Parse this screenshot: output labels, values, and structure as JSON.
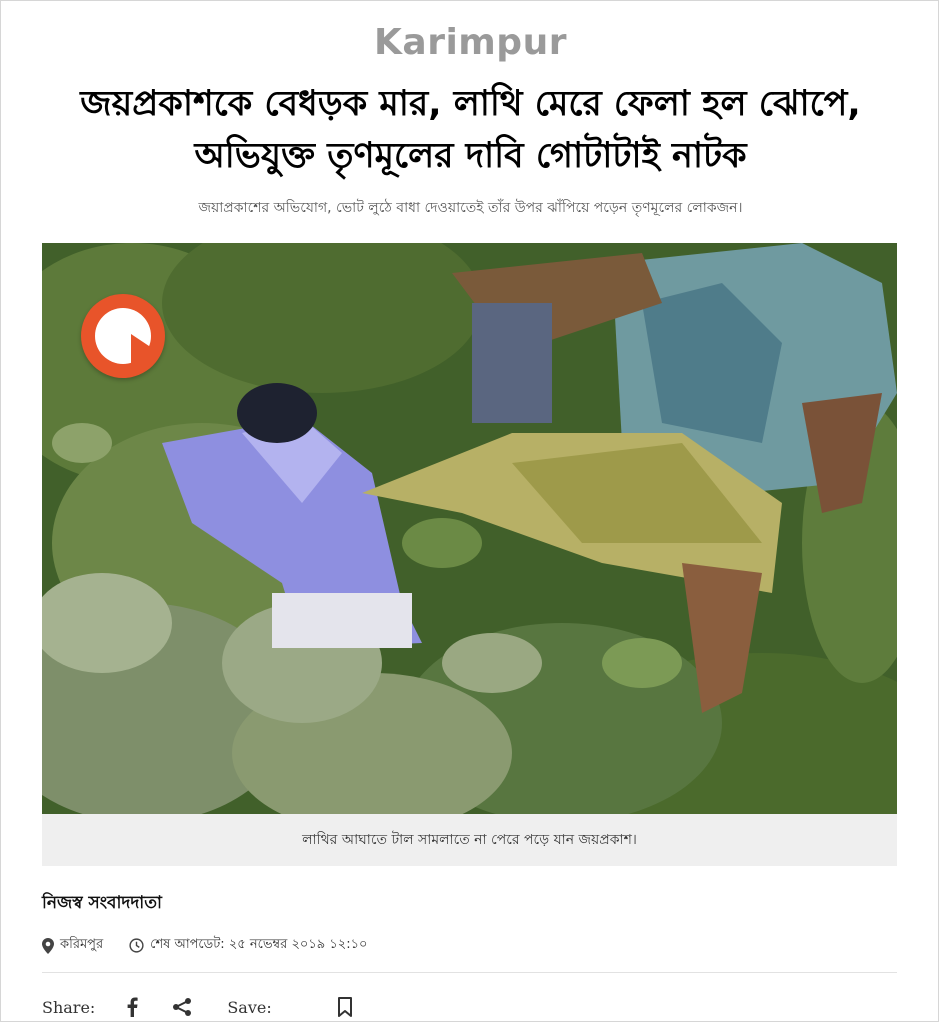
{
  "section": {
    "tag": "Karimpur"
  },
  "headline": {
    "line1": "জয়প্রকাশকে বেধড়ক মার, লাথি মেরে ফেলা হল ঝোপে,",
    "line2": "অভিযুক্ত তৃণমূলের দাবি গোটাটাই নাটক"
  },
  "subhead": "জয়াপ্রকাশের অভিযোগ, ভোট লুঠে বাধা দেওয়াতেই তাঁর উপর ঝাঁপিয়ে পড়েন তৃণমূলের লোকজন।",
  "media": {
    "play_icon": "play-icon",
    "caption": "লাথির আঘাতে টাল সামলাতে না পেরে পড়ে যান জয়প্রকাশ।"
  },
  "byline": "নিজস্ব সংবাদদাতা",
  "meta": {
    "location": "করিমপুর",
    "updated": "শেষ আপডেট: ২৫ নভেম্বর ২০১৯ ১২:১০",
    "location_icon": "location-pin-icon",
    "clock_icon": "clock-icon"
  },
  "share": {
    "share_label": "Share:",
    "save_label": "Save:",
    "facebook_icon": "facebook-icon",
    "share_icon": "share-icon",
    "bookmark_icon": "bookmark-icon"
  },
  "colors": {
    "accent": "#e8542a",
    "section_tag": "#9a9a9a",
    "caption_bg": "#efefef"
  }
}
